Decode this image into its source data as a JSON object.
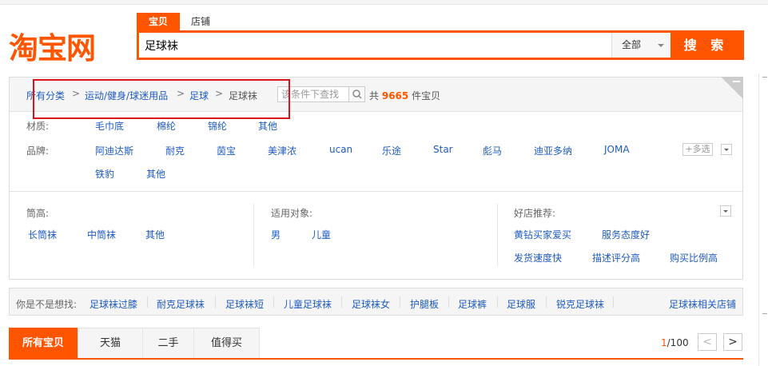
{
  "logo": {
    "text": "淘宝网"
  },
  "search": {
    "tabs": [
      "宝贝",
      "店铺"
    ],
    "query": "足球袜",
    "scope": "全部",
    "button": "搜 索"
  },
  "breadcrumb": {
    "items": [
      "所有分类",
      "运动/健身/球迷用品",
      "足球",
      "足球袜"
    ],
    "separator": ">",
    "filter_placeholder": "该条件下查找",
    "total_prefix": "共",
    "total_count": "9665",
    "total_suffix": "件宝贝"
  },
  "attributes": {
    "material": {
      "label": "材质:",
      "values": [
        "毛巾底",
        "棉纶",
        "锦纶",
        "其他"
      ]
    },
    "brand": {
      "label": "品牌:",
      "values": [
        "阿迪达斯",
        "耐克",
        "茵宝",
        "美津浓",
        "ucan",
        "乐途",
        "Star",
        "彪马",
        "迪亚多纳",
        "JOMA",
        "铁豹",
        "其他"
      ],
      "more": "+多选"
    },
    "tube": {
      "label": "筒高:",
      "values": [
        "长筒袜",
        "中筒袜",
        "其他"
      ]
    },
    "target": {
      "label": "适用对象:",
      "values": [
        "男",
        "儿童"
      ]
    },
    "shops": {
      "label": "好店推荐:",
      "values": [
        "黄钻买家爱买",
        "服务态度好",
        "发货速度快",
        "描述评分高",
        "购买比例高"
      ]
    }
  },
  "suggest": {
    "label": "你是不是想找:",
    "items": [
      "足球袜过膝",
      "耐克足球袜",
      "足球袜短",
      "儿童足球袜",
      "足球袜女",
      "护腿板",
      "足球裤",
      "足球服",
      "锐克足球袜"
    ],
    "related": "足球袜相关店铺"
  },
  "result_tabs": [
    "所有宝贝",
    "天猫",
    "二手",
    "值得买"
  ],
  "pager": {
    "current": "1",
    "total": "/100",
    "prev": "<",
    "next": ">"
  },
  "colors": {
    "accent": "#ff5500",
    "link": "#1f5bbf",
    "highlight_box": "#d9151b"
  }
}
